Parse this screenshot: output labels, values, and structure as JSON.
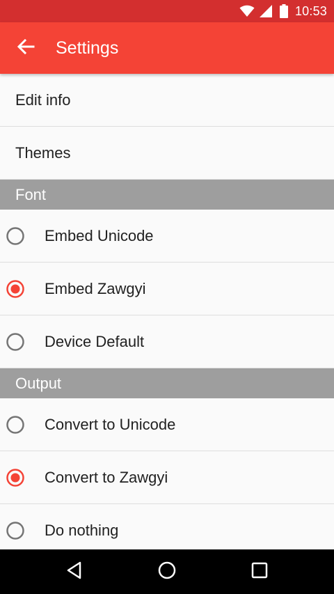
{
  "status_bar": {
    "time": "10:53",
    "icons": [
      "wifi-icon",
      "signal-icon",
      "battery-icon"
    ]
  },
  "app_bar": {
    "back_icon": "arrow-back-icon",
    "title": "Settings"
  },
  "menu": {
    "edit_info": "Edit info",
    "themes": "Themes"
  },
  "font_section": {
    "header": "Font",
    "options": [
      {
        "label": "Embed Unicode",
        "selected": false
      },
      {
        "label": "Embed Zawgyi",
        "selected": true
      },
      {
        "label": "Device Default",
        "selected": false
      }
    ]
  },
  "output_section": {
    "header": "Output",
    "options": [
      {
        "label": "Convert to Unicode",
        "selected": false
      },
      {
        "label": "Convert to Zawgyi",
        "selected": true
      },
      {
        "label": "Do nothing",
        "selected": false
      }
    ]
  },
  "nav_bar": {
    "buttons": [
      "back-triangle-icon",
      "home-circle-icon",
      "recents-square-icon"
    ]
  },
  "colors": {
    "status_bar": "#d32f2f",
    "app_bar": "#f44336",
    "accent": "#f44336",
    "section_header": "#9e9e9e",
    "radio_unchecked": "#757575"
  }
}
